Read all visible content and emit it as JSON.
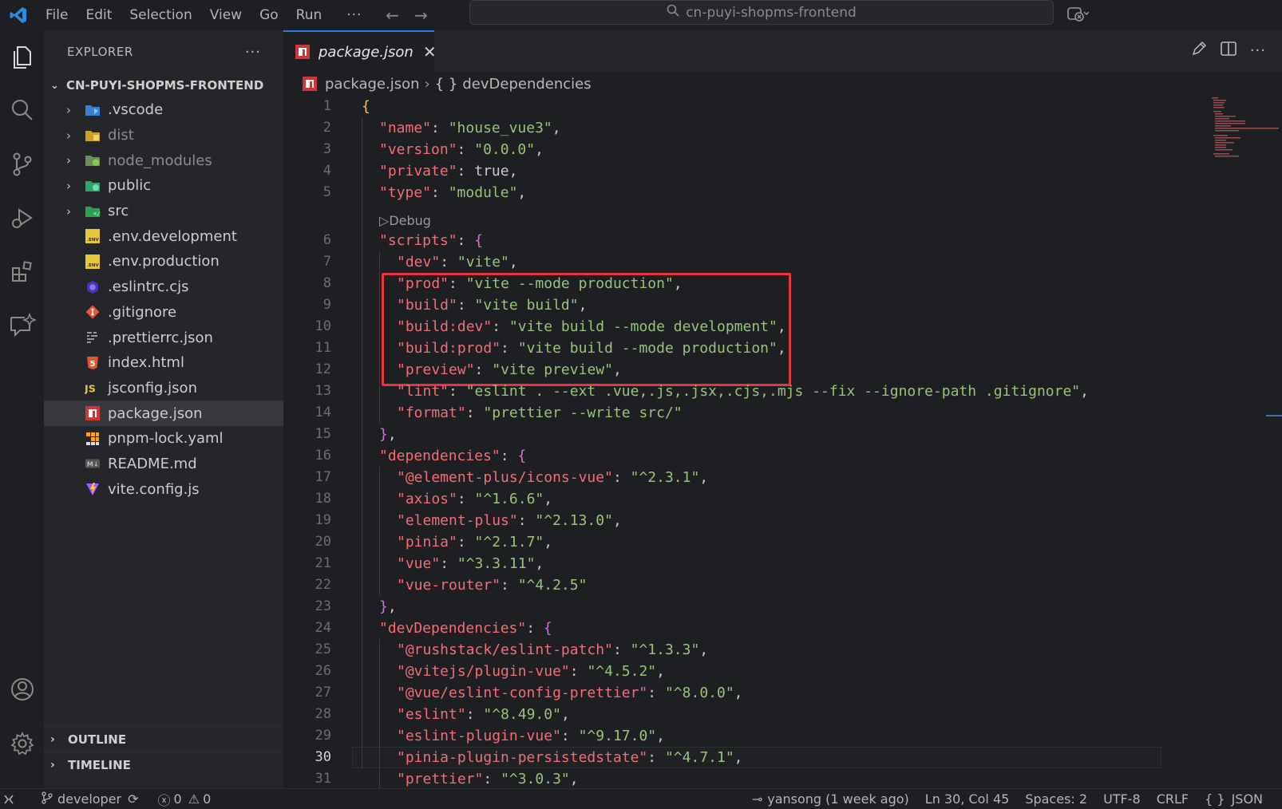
{
  "titlebar": {
    "menus": [
      "File",
      "Edit",
      "Selection",
      "View",
      "Go",
      "Run"
    ],
    "more": "···",
    "search_text": "cn-puyi-shopms-frontend"
  },
  "sidebar": {
    "title": "EXPLORER",
    "more": "···",
    "workspace": "CN-PUYI-SHOPMS-FRONTEND",
    "items": [
      {
        "name": ".vscode",
        "type": "folder",
        "icon": "vscode-folder-icon"
      },
      {
        "name": "dist",
        "type": "folder",
        "icon": "dist-folder-icon"
      },
      {
        "name": "node_modules",
        "type": "folder",
        "icon": "node-folder-icon"
      },
      {
        "name": "public",
        "type": "folder",
        "icon": "public-folder-icon"
      },
      {
        "name": "src",
        "type": "folder",
        "icon": "src-folder-icon"
      },
      {
        "name": ".env.development",
        "type": "file",
        "icon": "env-file-icon"
      },
      {
        "name": ".env.production",
        "type": "file",
        "icon": "env-file-icon"
      },
      {
        "name": ".eslintrc.cjs",
        "type": "file",
        "icon": "eslint-file-icon"
      },
      {
        "name": ".gitignore",
        "type": "file",
        "icon": "git-file-icon"
      },
      {
        "name": ".prettierrc.json",
        "type": "file",
        "icon": "prettier-file-icon"
      },
      {
        "name": "index.html",
        "type": "file",
        "icon": "html-file-icon"
      },
      {
        "name": "jsconfig.json",
        "type": "file",
        "icon": "js-file-icon"
      },
      {
        "name": "package.json",
        "type": "file",
        "icon": "npm-file-icon"
      },
      {
        "name": "pnpm-lock.yaml",
        "type": "file",
        "icon": "pnpm-file-icon"
      },
      {
        "name": "README.md",
        "type": "file",
        "icon": "markdown-file-icon"
      },
      {
        "name": "vite.config.js",
        "type": "file",
        "icon": "vite-file-icon"
      }
    ],
    "outline": "OUTLINE",
    "timeline": "TIMELINE"
  },
  "editor": {
    "tab_title": "package.json",
    "breadcrumb": {
      "file": "package.json",
      "symbol": "devDependencies"
    },
    "codelens": "Debug",
    "current_line": 30,
    "lines": [
      {
        "n": "1",
        "t": "{"
      },
      {
        "n": "2",
        "t": "\"name\": \"house_vue3\","
      },
      {
        "n": "3",
        "t": "\"version\": \"0.0.0\","
      },
      {
        "n": "4",
        "t": "\"private\": true,"
      },
      {
        "n": "5",
        "t": "\"type\": \"module\","
      },
      {
        "n": "6",
        "t": "\"scripts\": {"
      },
      {
        "n": "7",
        "t": "\"dev\": \"vite\","
      },
      {
        "n": "8",
        "t": "\"prod\": \"vite --mode production\","
      },
      {
        "n": "9",
        "t": "\"build\": \"vite build\","
      },
      {
        "n": "10",
        "t": "\"build:dev\": \"vite build --mode development\","
      },
      {
        "n": "11",
        "t": "\"build:prod\": \"vite build --mode production\","
      },
      {
        "n": "12",
        "t": "\"preview\": \"vite preview\","
      },
      {
        "n": "13",
        "t": "\"lint\": \"eslint . --ext .vue,.js,.jsx,.cjs,.mjs --fix --ignore-path .gitignore\","
      },
      {
        "n": "14",
        "t": "\"format\": \"prettier --write src/\""
      },
      {
        "n": "15",
        "t": "},"
      },
      {
        "n": "16",
        "t": "\"dependencies\": {"
      },
      {
        "n": "17",
        "t": "\"@element-plus/icons-vue\": \"^2.3.1\","
      },
      {
        "n": "18",
        "t": "\"axios\": \"^1.6.6\","
      },
      {
        "n": "19",
        "t": "\"element-plus\": \"^2.13.0\","
      },
      {
        "n": "20",
        "t": "\"pinia\": \"^2.1.7\","
      },
      {
        "n": "21",
        "t": "\"vue\": \"^3.3.11\","
      },
      {
        "n": "22",
        "t": "\"vue-router\": \"^4.2.5\""
      },
      {
        "n": "23",
        "t": "},"
      },
      {
        "n": "24",
        "t": "\"devDependencies\": {"
      },
      {
        "n": "25",
        "t": "\"@rushstack/eslint-patch\": \"^1.3.3\","
      },
      {
        "n": "26",
        "t": "\"@vitejs/plugin-vue\": \"^4.5.2\","
      },
      {
        "n": "27",
        "t": "\"@vue/eslint-config-prettier\": \"^8.0.0\","
      },
      {
        "n": "28",
        "t": "\"eslint\": \"^8.49.0\","
      },
      {
        "n": "29",
        "t": "\"eslint-plugin-vue\": \"^9.17.0\","
      },
      {
        "n": "30",
        "t": "\"pinia-plugin-persistedstate\": \"^4.7.1\","
      },
      {
        "n": "31",
        "t": "\"prettier\": \"^3.0.3\","
      }
    ]
  },
  "statusbar": {
    "branch": "developer",
    "errors": "0",
    "warnings": "0",
    "blame": "yansong (1 week ago)",
    "position": "Ln 30, Col 45",
    "spaces": "Spaces: 2",
    "encoding": "UTF-8",
    "eol": "CRLF",
    "language": "JSON"
  },
  "colors": {
    "accent": "#2d7bd8",
    "highlight_box": "#e8343e",
    "key": "#f26d78",
    "string": "#98c379"
  }
}
